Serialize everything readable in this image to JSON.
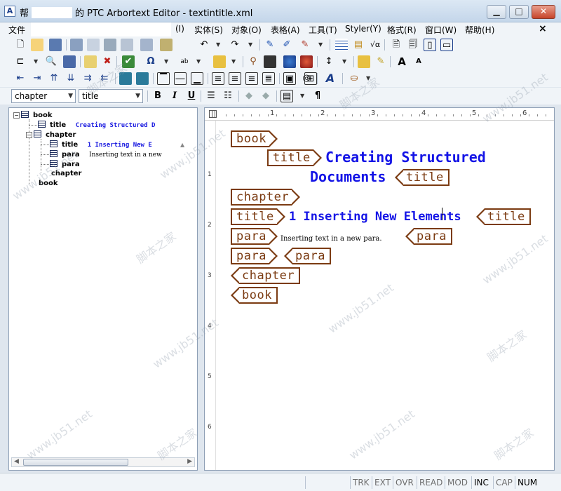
{
  "window": {
    "title_prefix": "帮",
    "title_suffix": "的 PTC Arbortext Editor - textintitle.xml",
    "icon_label": "A"
  },
  "menu": {
    "first": "文件",
    "items": [
      "(I)",
      "实体(S)",
      "对象(O)",
      "表格(A)",
      "工具(T)",
      "Styler(Y)",
      "格式(R)",
      "窗口(W)",
      "帮助(H)"
    ],
    "close": "×"
  },
  "format_bar": {
    "element_combo": "chapter",
    "style_combo": "title",
    "bold": "B",
    "italic": "I",
    "underline": "U",
    "pilcrow": "¶"
  },
  "tree": {
    "rows": [
      {
        "tag": "book"
      },
      {
        "tag": "title",
        "content": "Creating Structured D"
      },
      {
        "tag": "chapter"
      },
      {
        "tag": "title",
        "content": "1 Inserting New E"
      },
      {
        "tag": "para",
        "content": "Inserting text in a new"
      },
      {
        "tag": "para"
      },
      {
        "tag": "chapter"
      },
      {
        "tag": "book"
      }
    ]
  },
  "ruler": {
    "h_numbers": [
      "1",
      "2",
      "3",
      "4",
      "5",
      "6"
    ],
    "v_numbers": [
      "1",
      "2",
      "3",
      "4",
      "5",
      "6"
    ]
  },
  "document": {
    "book_open": "book",
    "title1_open": "title",
    "title1_line1": "Creating Structured",
    "title1_line2": "Documents",
    "title1_close": "title",
    "chapter_open": "chapter",
    "title2_open": "title",
    "title2_text": "1 Inserting New Elements",
    "title2_close": "title",
    "para1_open": "para",
    "para1_text": "Inserting text in a new para.",
    "para1_close": "para",
    "para2_open": "para",
    "para2_close": "para",
    "chapter_close": "chapter",
    "book_close": "book"
  },
  "status": {
    "cells": [
      "TRK",
      "EXT",
      "OVR",
      "READ",
      "MOD",
      "INC",
      "CAP",
      "NUM"
    ]
  },
  "watermark": {
    "site": "www.jb51.net",
    "name": "脚本之家"
  },
  "colors": {
    "tag_brown": "#7b3b12",
    "title_blue": "#1414e6"
  }
}
